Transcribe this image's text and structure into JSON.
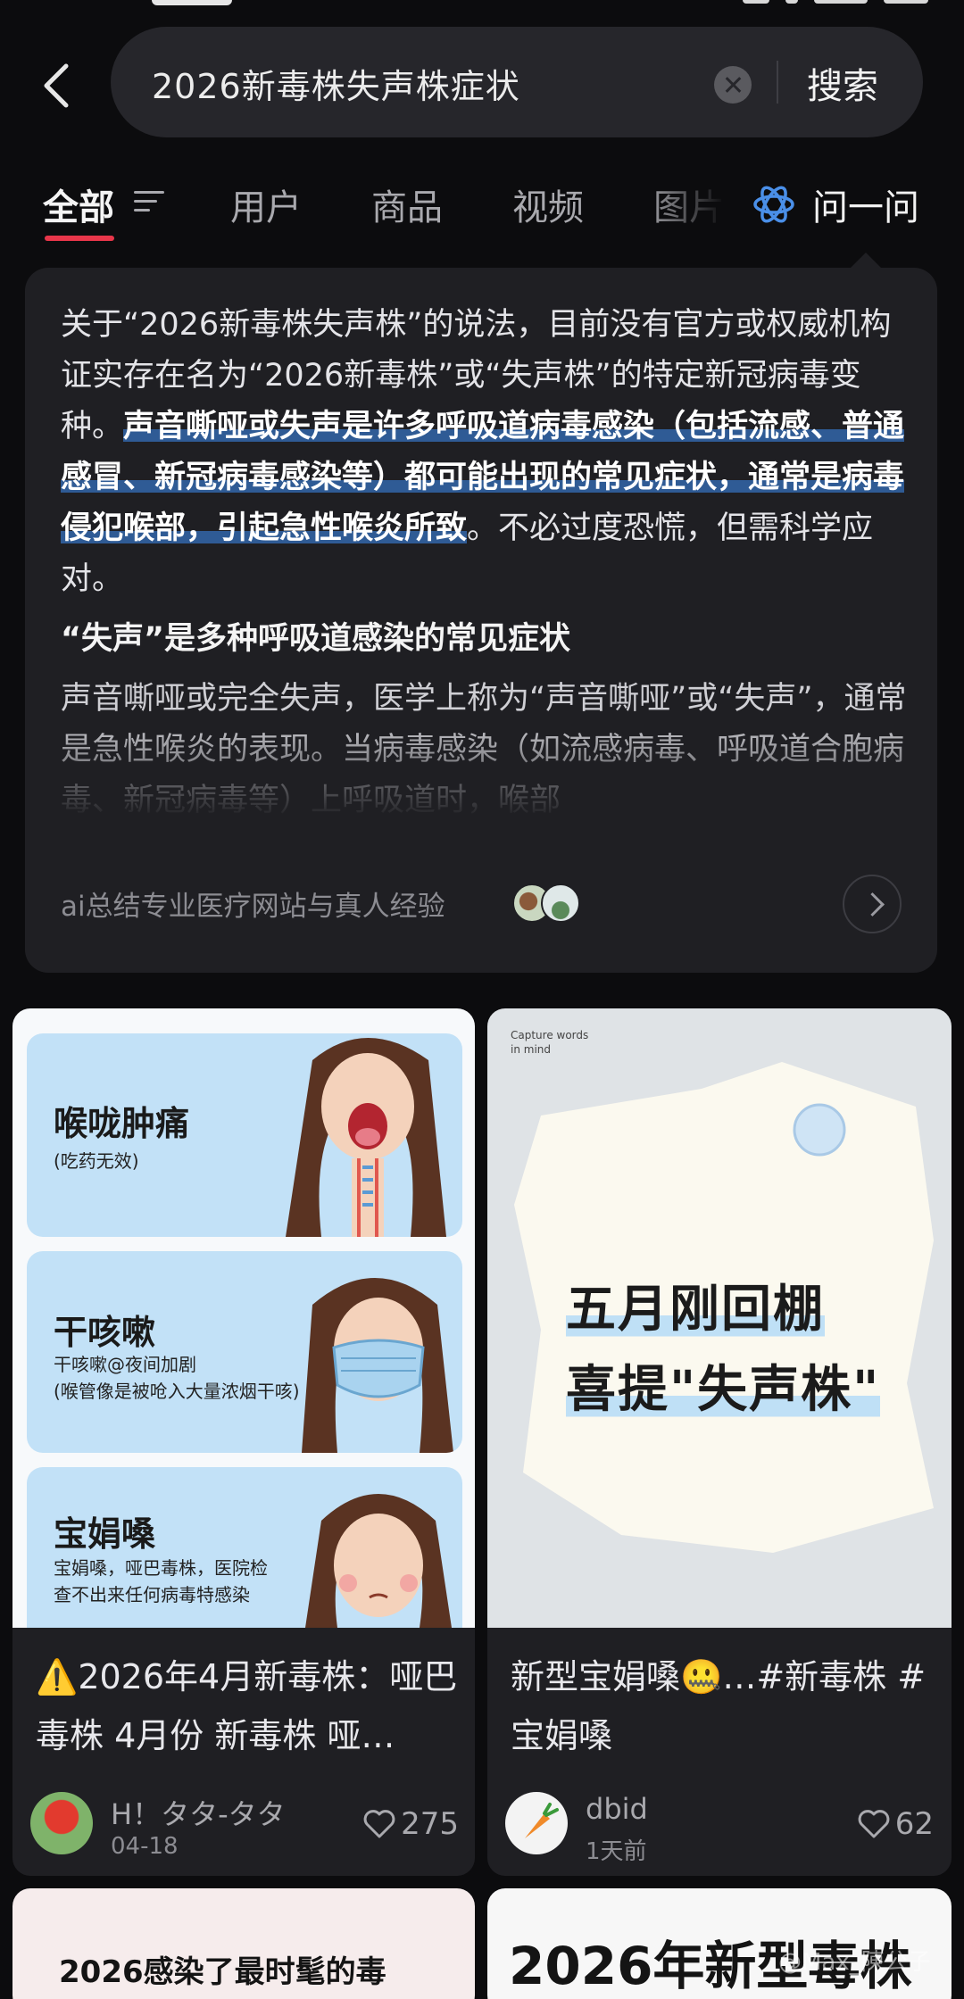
{
  "search": {
    "query": "2026新毒株失声株症状",
    "submit_label": "搜索"
  },
  "tabs": {
    "items": [
      {
        "label": "全部",
        "active": true
      },
      {
        "label": "用户"
      },
      {
        "label": "商品"
      },
      {
        "label": "视频"
      },
      {
        "label": "图片"
      }
    ],
    "ask_label": "问一问"
  },
  "ai_summary": {
    "intro_plain": "关于“2026新毒株失声株”的说法，目前没有官方或权威机构证实存在名为“2026新毒株”或“失声株”的特定新冠病毒变种。",
    "intro_highlight": "声音嘶哑或失声是许多呼吸道病毒感染（包括流感、普通感冒、新冠病毒感染等）都可能出现的常见症状，通常是病毒侵犯喉部，引起急性喉炎所致",
    "intro_tail": "。不必过度恐慌，但需科学应对。",
    "subheading": "“失声”是多种呼吸道感染的常见症状",
    "detail": "声音嘶哑或完全失声，医学上称为“声音嘶哑”或“失声”，通常是急性喉炎的表现。当病毒感染（如流感病毒、呼吸道合胞病毒、新冠病毒等）上呼吸道时，喉部",
    "source": "ai总结专业医疗网站与真人经验"
  },
  "results": [
    {
      "title": "⚠️2026年4月新毒株：哑巴毒株 4月份 新毒株 哑…",
      "author": "H！タタ-タタ",
      "date": "04-18",
      "likes": "275",
      "image": {
        "panels": [
          {
            "title": "喉咙肿痛",
            "sub": [
              "(吃药无效)"
            ]
          },
          {
            "title": "干咳嗽",
            "sub": [
              "干咳嗽@夜间加剧",
              "(喉管像是被呛入大量浓烟干咳)"
            ]
          },
          {
            "title": "宝娟嗓",
            "sub": [
              "宝娟嗓，哑巴毒株，医院检",
              "查不出来任何病毒特感染"
            ]
          }
        ]
      }
    },
    {
      "title": "新型宝娟嗓🤐…#新毒株 #宝娟嗓",
      "author": "dbid",
      "date": "1天前",
      "likes": "62",
      "image": {
        "tag": [
          "Capture words",
          "in mind"
        ],
        "lines": [
          "五月刚回棚",
          "喜提\"失声株\""
        ]
      }
    }
  ],
  "peek_cards": [
    {
      "text": "2026感染了最时髦的毒"
    },
    {
      "text": "2026年新型毒株"
    }
  ],
  "watermark": "@Max_陳公子",
  "colors": {
    "background": "#0c0c0e",
    "card": "#1f1f23",
    "accent_underline": "#e8364a",
    "highlight": "#2f5b95",
    "ask_icon": "#4a8fe8"
  }
}
